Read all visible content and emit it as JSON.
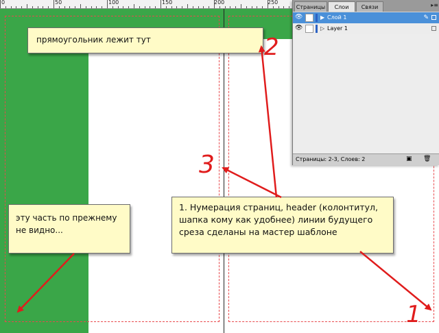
{
  "ruler": {
    "labels": [
      "0",
      "50",
      "100",
      "150",
      "200",
      "250"
    ]
  },
  "callouts": {
    "rect_here": "прямоугольник лежит тут",
    "not_visible_line1": "эту часть по прежнему",
    "not_visible_line2": "не видно...",
    "master_line1": "1. Нумерация страниц, header (колонтитул,",
    "master_line2": "шапка кому как удобнее) линии будущего",
    "master_line3": "среза сделаны на мастер шаблоне"
  },
  "annotations": {
    "num1": "1",
    "num2": "2",
    "num3": "3"
  },
  "layers_panel": {
    "tabs": [
      "Страницы",
      "Слои",
      "Связи"
    ],
    "active_tab": "Слои",
    "menu_glyph": "▸≡",
    "layers": [
      {
        "name": "Слой 1",
        "selected": true
      },
      {
        "name": "Layer 1",
        "selected": false
      }
    ],
    "status_text": "Страницы: 2-3, Слоев: 2"
  },
  "colors": {
    "green": "#3aa648",
    "arrow_red": "#e01c1c",
    "callout_bg": "#fffbc7",
    "selection_blue": "#4a90d9"
  }
}
